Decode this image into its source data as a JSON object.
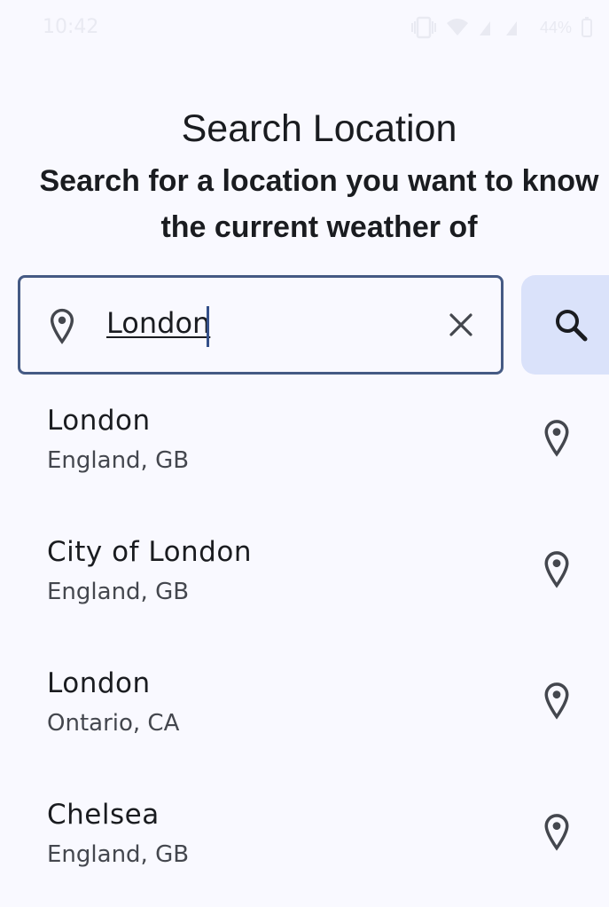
{
  "status_bar": {
    "time": "10:42",
    "battery": "44%"
  },
  "header": {
    "title": "Search Location",
    "subtitle": "Search for a location you want to know the current weather of"
  },
  "search": {
    "value": "London",
    "leading_icon": "location-pin-icon",
    "clear_icon": "close-icon",
    "button_icon": "search-icon"
  },
  "results": [
    {
      "name": "London",
      "region": "England, GB",
      "icon": "location-pin-icon"
    },
    {
      "name": "City of London",
      "region": "England, GB",
      "icon": "location-pin-icon"
    },
    {
      "name": "London",
      "region": "Ontario, CA",
      "icon": "location-pin-icon"
    },
    {
      "name": "Chelsea",
      "region": "England, GB",
      "icon": "location-pin-icon"
    }
  ],
  "colors": {
    "background": "#f9f9ff",
    "outline": "#455a84",
    "search_button": "#dae2fa",
    "text": "#1a1c20",
    "secondary_text": "#44474e"
  }
}
